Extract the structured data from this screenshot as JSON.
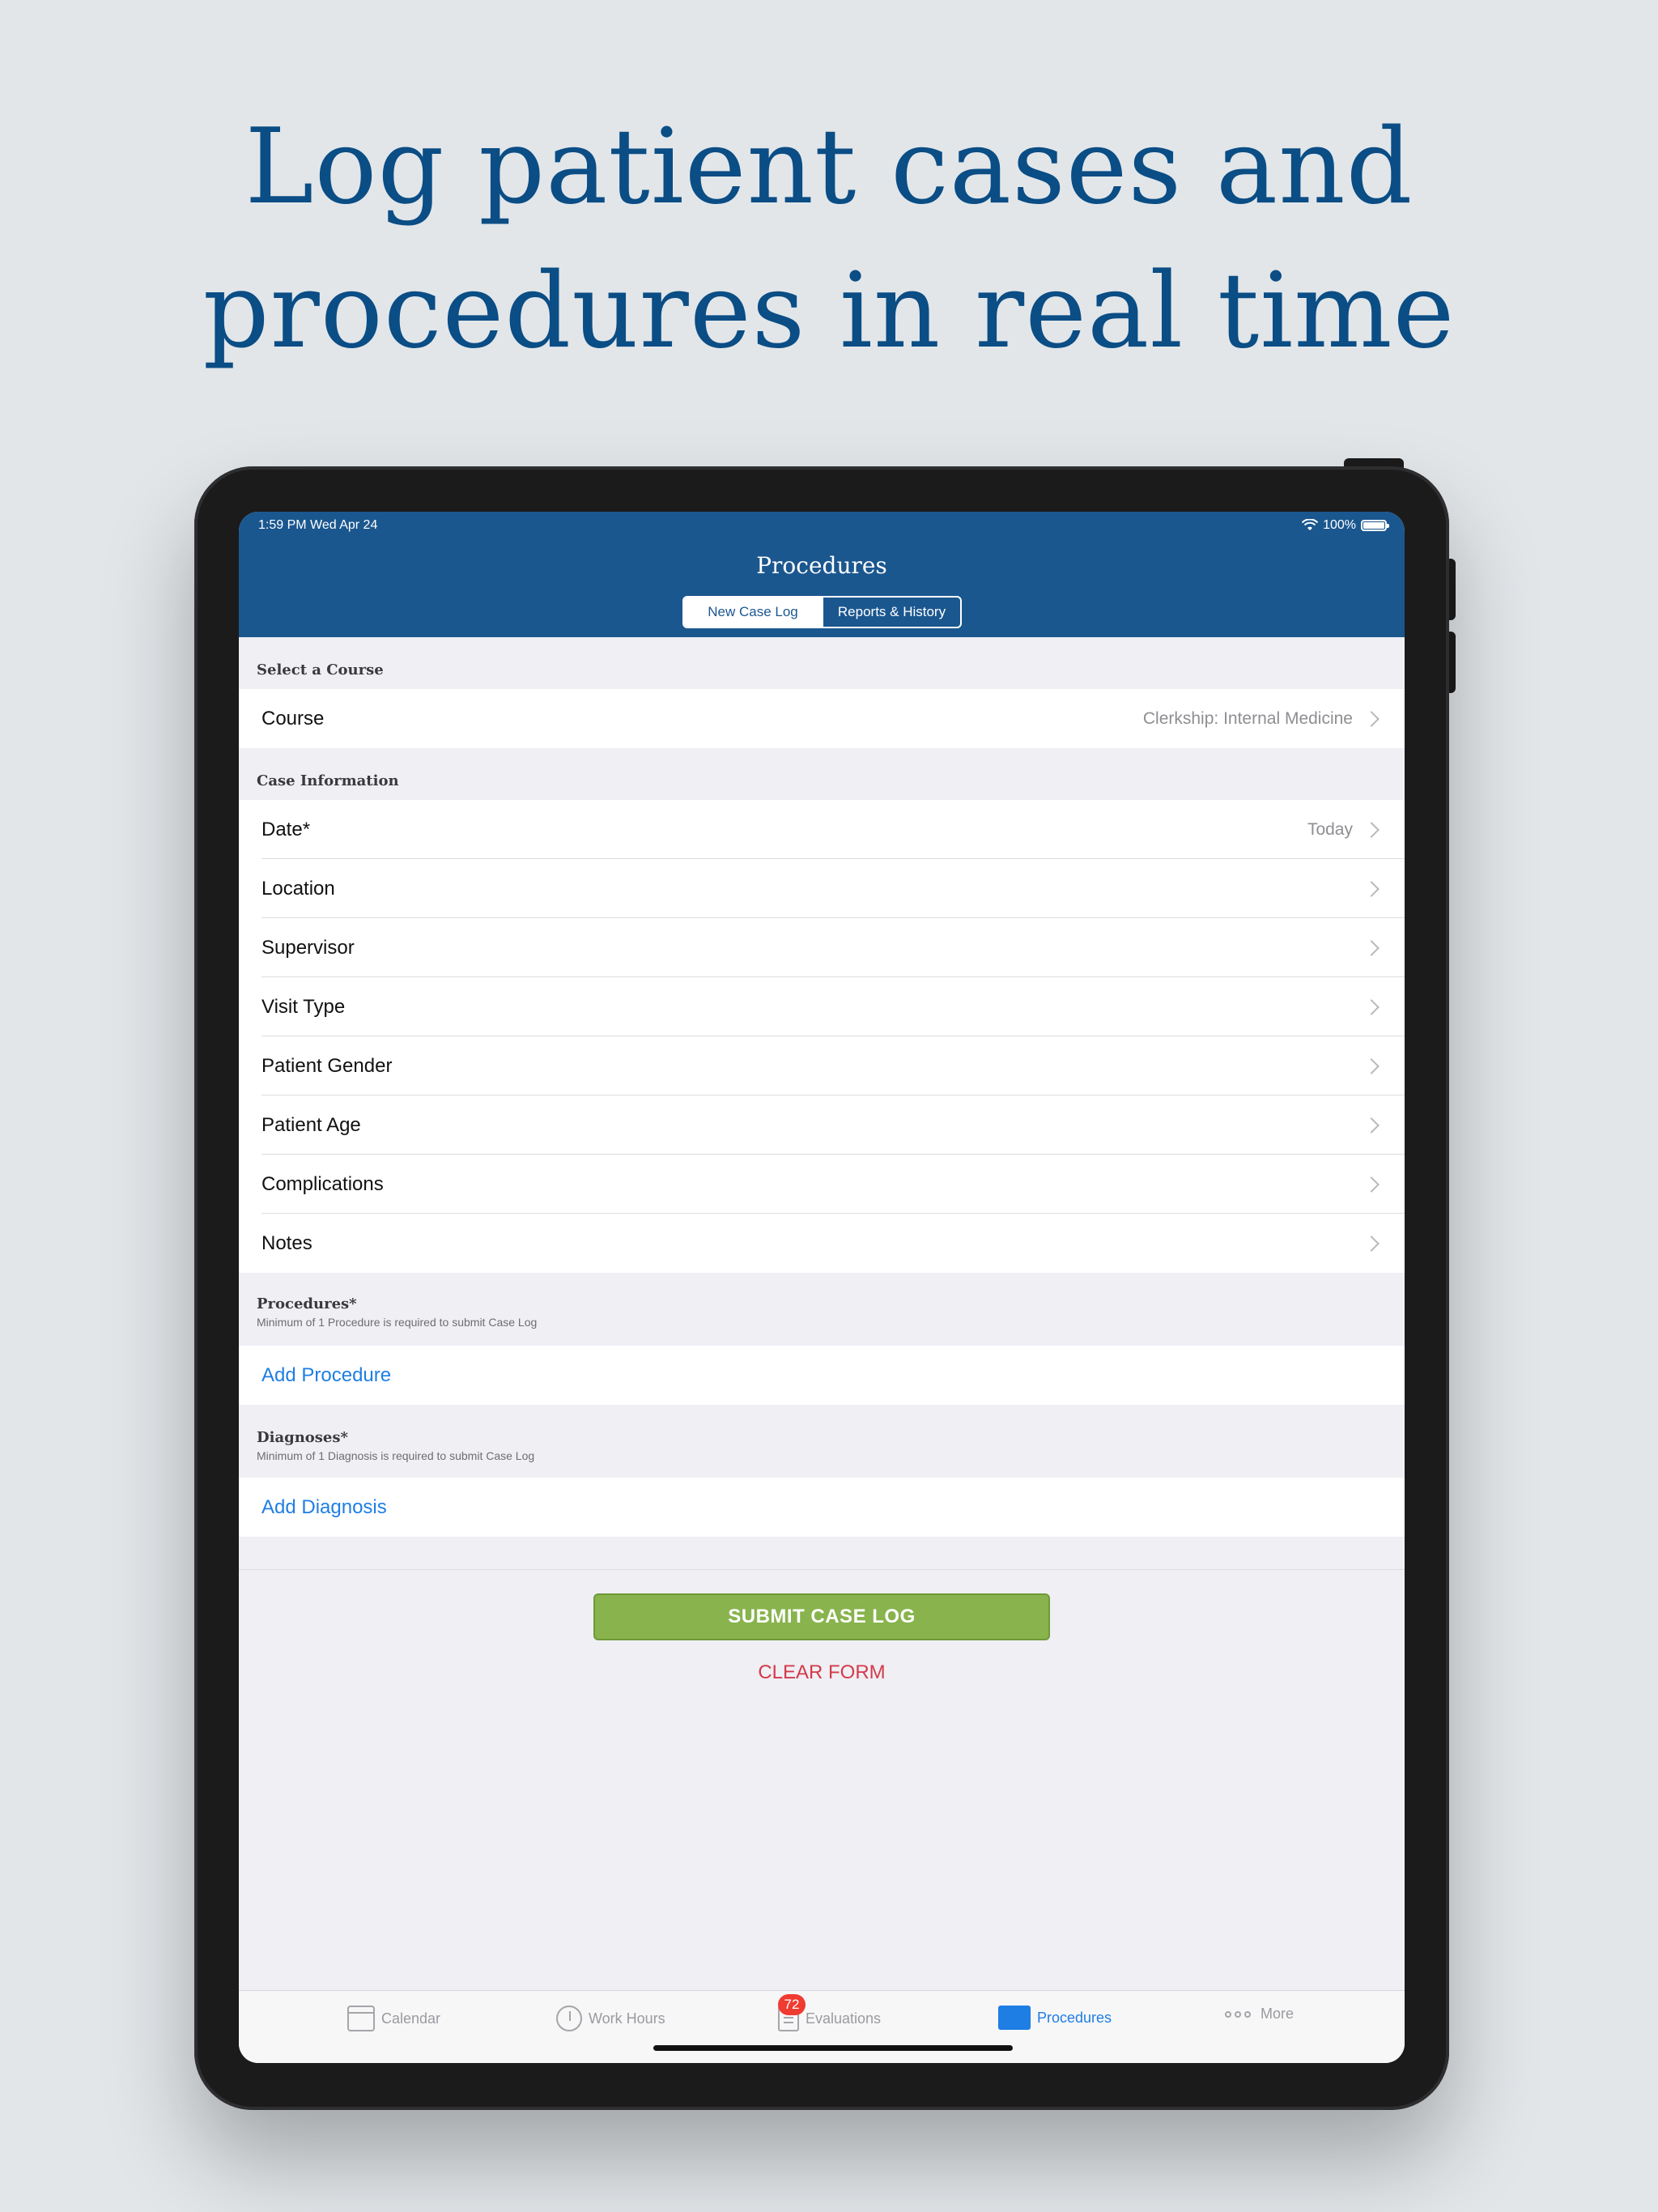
{
  "headline": {
    "line1": "Log patient cases and",
    "line2": "procedures in real time"
  },
  "status_bar": {
    "time": "1:59 PM   Wed Apr 24",
    "battery": "100%"
  },
  "nav": {
    "title": "Procedures",
    "segments": [
      {
        "label": "New Case Log",
        "selected": true
      },
      {
        "label": "Reports & History",
        "selected": false
      }
    ]
  },
  "sections": {
    "course": {
      "title": "Select a Course"
    },
    "case_info": {
      "title": "Case Information"
    },
    "procedures": {
      "title": "Procedures*",
      "subtitle": "Minimum of 1 Procedure is required to submit Case Log"
    },
    "diagnoses": {
      "title": "Diagnoses*",
      "subtitle": "Minimum of 1 Diagnosis is required to submit Case Log"
    }
  },
  "rows": {
    "course": {
      "label": "Course",
      "value": "Clerkship: Internal Medicine"
    },
    "date": {
      "label": "Date*",
      "value": "Today"
    },
    "location": {
      "label": "Location"
    },
    "supervisor": {
      "label": "Supervisor"
    },
    "visit_type": {
      "label": "Visit Type"
    },
    "patient_gender": {
      "label": "Patient Gender"
    },
    "patient_age": {
      "label": "Patient Age"
    },
    "complications": {
      "label": "Complications"
    },
    "notes": {
      "label": "Notes"
    },
    "add_procedure": {
      "label": "Add Procedure"
    },
    "add_diagnosis": {
      "label": "Add Diagnosis"
    }
  },
  "actions": {
    "submit": "SUBMIT CASE LOG",
    "clear": "CLEAR FORM"
  },
  "tabbar": {
    "tabs": [
      {
        "label": "Calendar",
        "icon": "calendar-icon"
      },
      {
        "label": "Work Hours",
        "icon": "stopwatch-icon"
      },
      {
        "label": "Evaluations",
        "icon": "evaluations-icon",
        "badge": "72"
      },
      {
        "label": "Procedures",
        "icon": "folder-icon",
        "active": true
      },
      {
        "label": "More",
        "icon": "more-icon"
      }
    ]
  },
  "colors": {
    "nav": "#1b578f",
    "accent": "#1f7ee4",
    "submit": "#88b34d",
    "clear": "#d43a4a",
    "headline": "#0b4d85"
  }
}
